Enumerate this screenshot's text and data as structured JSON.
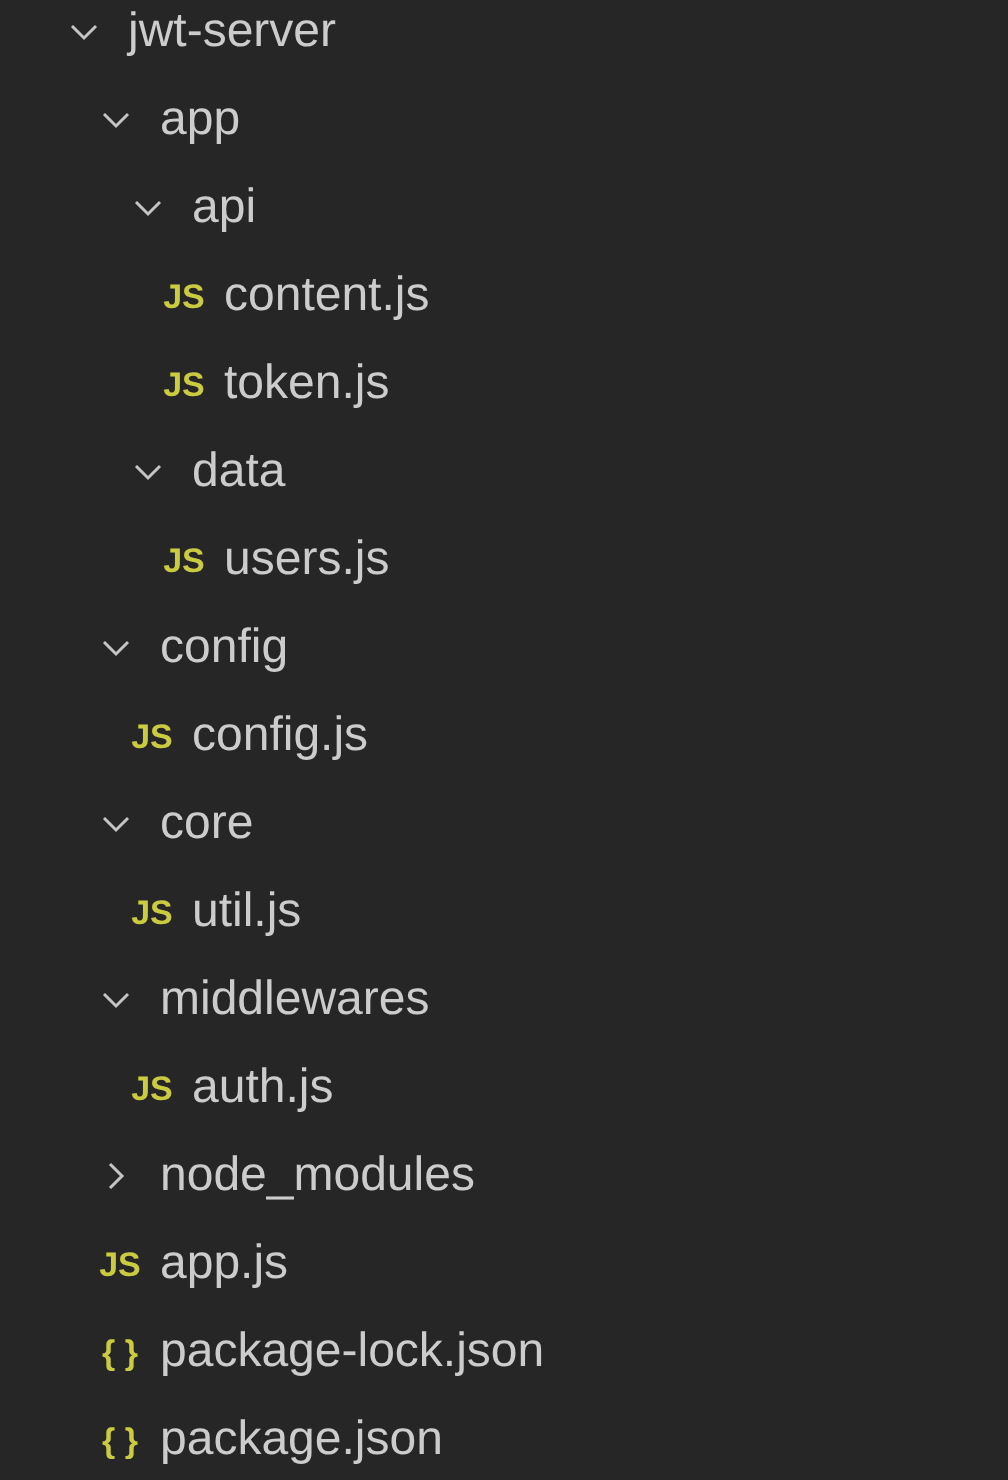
{
  "tree": [
    {
      "name": "jwt-server",
      "expanded": true,
      "children": [
        {
          "name": "app",
          "expanded": true,
          "children": [
            {
              "name": "api",
              "expanded": true,
              "children": [
                {
                  "name": "content.js",
                  "icon": "JS"
                },
                {
                  "name": "token.js",
                  "icon": "JS"
                }
              ]
            },
            {
              "name": "data",
              "expanded": true,
              "children": [
                {
                  "name": "users.js",
                  "icon": "JS"
                }
              ]
            }
          ]
        },
        {
          "name": "config",
          "expanded": true,
          "children": [
            {
              "name": "config.js",
              "icon": "JS"
            }
          ]
        },
        {
          "name": "core",
          "expanded": true,
          "children": [
            {
              "name": "util.js",
              "icon": "JS"
            }
          ]
        },
        {
          "name": "middlewares",
          "expanded": true,
          "children": [
            {
              "name": "auth.js",
              "icon": "JS"
            }
          ]
        },
        {
          "name": "node_modules",
          "expanded": false
        },
        {
          "name": "app.js",
          "icon": "JS"
        },
        {
          "name": "package-lock.json",
          "icon": "{ }"
        },
        {
          "name": "package.json",
          "icon": "{ }"
        }
      ]
    }
  ]
}
